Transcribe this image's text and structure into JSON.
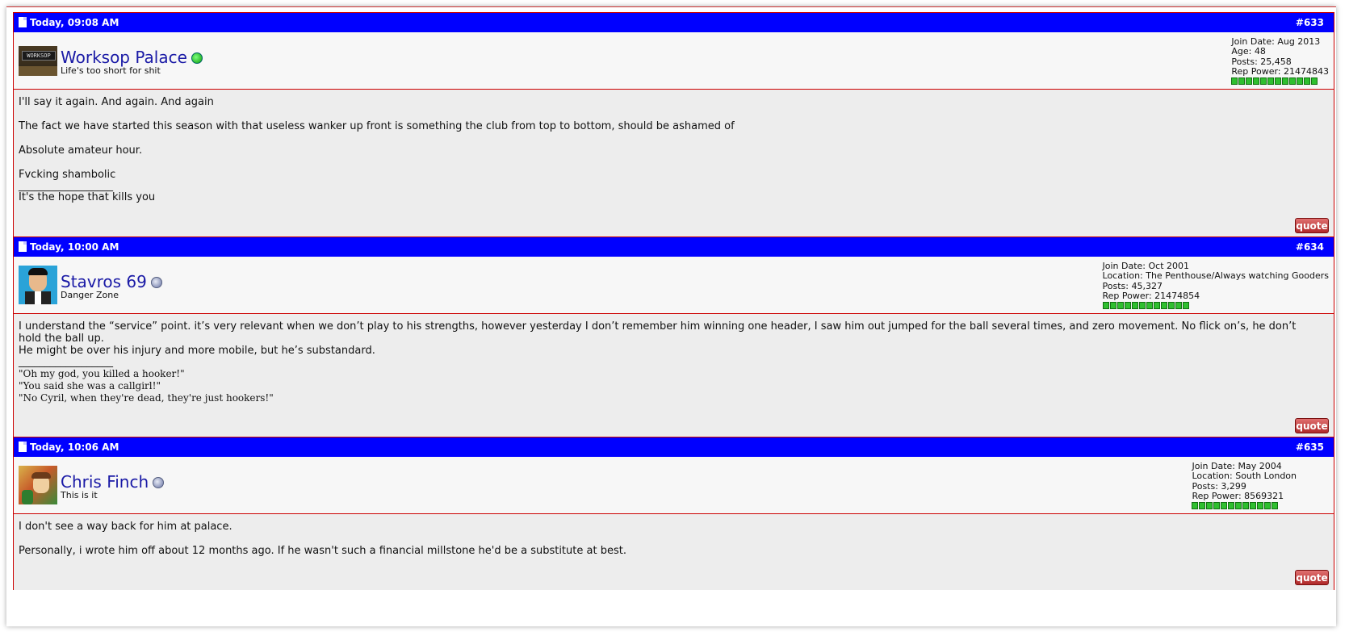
{
  "posts": [
    {
      "date": "Today, 09:08 AM",
      "number": "#633",
      "username": "Worksop Palace",
      "user_title": "Life's too short for shit",
      "status": "online",
      "avatar_text": "WORKSOP",
      "stats": [
        "Join Date: Aug 2013",
        "Age: 48",
        "Posts: 25,458",
        "Rep Power: 21474843"
      ],
      "rep_pips": 12,
      "body": [
        "I'll say it again. And again. And again",
        "The fact we have started this season with that useless wanker up front is something the club from top to bottom, should be ashamed of",
        "Absolute amateur hour.",
        "Fvcking shambolic"
      ],
      "sig_line": "__________________",
      "signature": [
        "It's the hope that kills you"
      ],
      "quote_label": "quote"
    },
    {
      "date": "Today, 10:00 AM",
      "number": "#634",
      "username": "Stavros 69",
      "user_title": "Danger Zone",
      "status": "offline",
      "stats": [
        "Join Date: Oct 2001",
        "Location: The Penthouse/Always watching Gooders",
        "Posts: 45,327",
        "Rep Power: 21474854"
      ],
      "rep_pips": 12,
      "body": [
        "I understand the “service” point. it’s very relevant when we don’t play to his strengths, however yesterday I don’t remember him winning one header, I saw him out jumped for the ball several times, and zero movement. No flick on’s, he don’t hold the ball up.",
        "He might be over his injury and more mobile, but he’s substandard."
      ],
      "sig_line": "__________________",
      "signature": [
        "\"Oh my god, you killed a hooker!\"",
        "\"You said she was a callgirl!\"",
        "\"No Cyril, when they're dead, they're just hookers!\""
      ],
      "quote_label": "quote"
    },
    {
      "date": "Today, 10:06 AM",
      "number": "#635",
      "username": "Chris Finch",
      "user_title": "This is it",
      "status": "offline",
      "stats": [
        "Join Date: May 2004",
        "Location: South London",
        "Posts: 3,299",
        "Rep Power: 8569321"
      ],
      "rep_pips": 12,
      "body": [
        "I don't see a way back for him at palace.",
        "Personally, i wrote him off about 12 months ago. If he wasn't such a financial millstone he'd be a substitute at best."
      ],
      "quote_label": "quote"
    }
  ],
  "colors": {
    "header_bg": "#0000ff",
    "border": "#cc0000",
    "username": "#1a1aa6",
    "quote_button": "#c03030",
    "rep_pip": "#2fbf2f"
  }
}
